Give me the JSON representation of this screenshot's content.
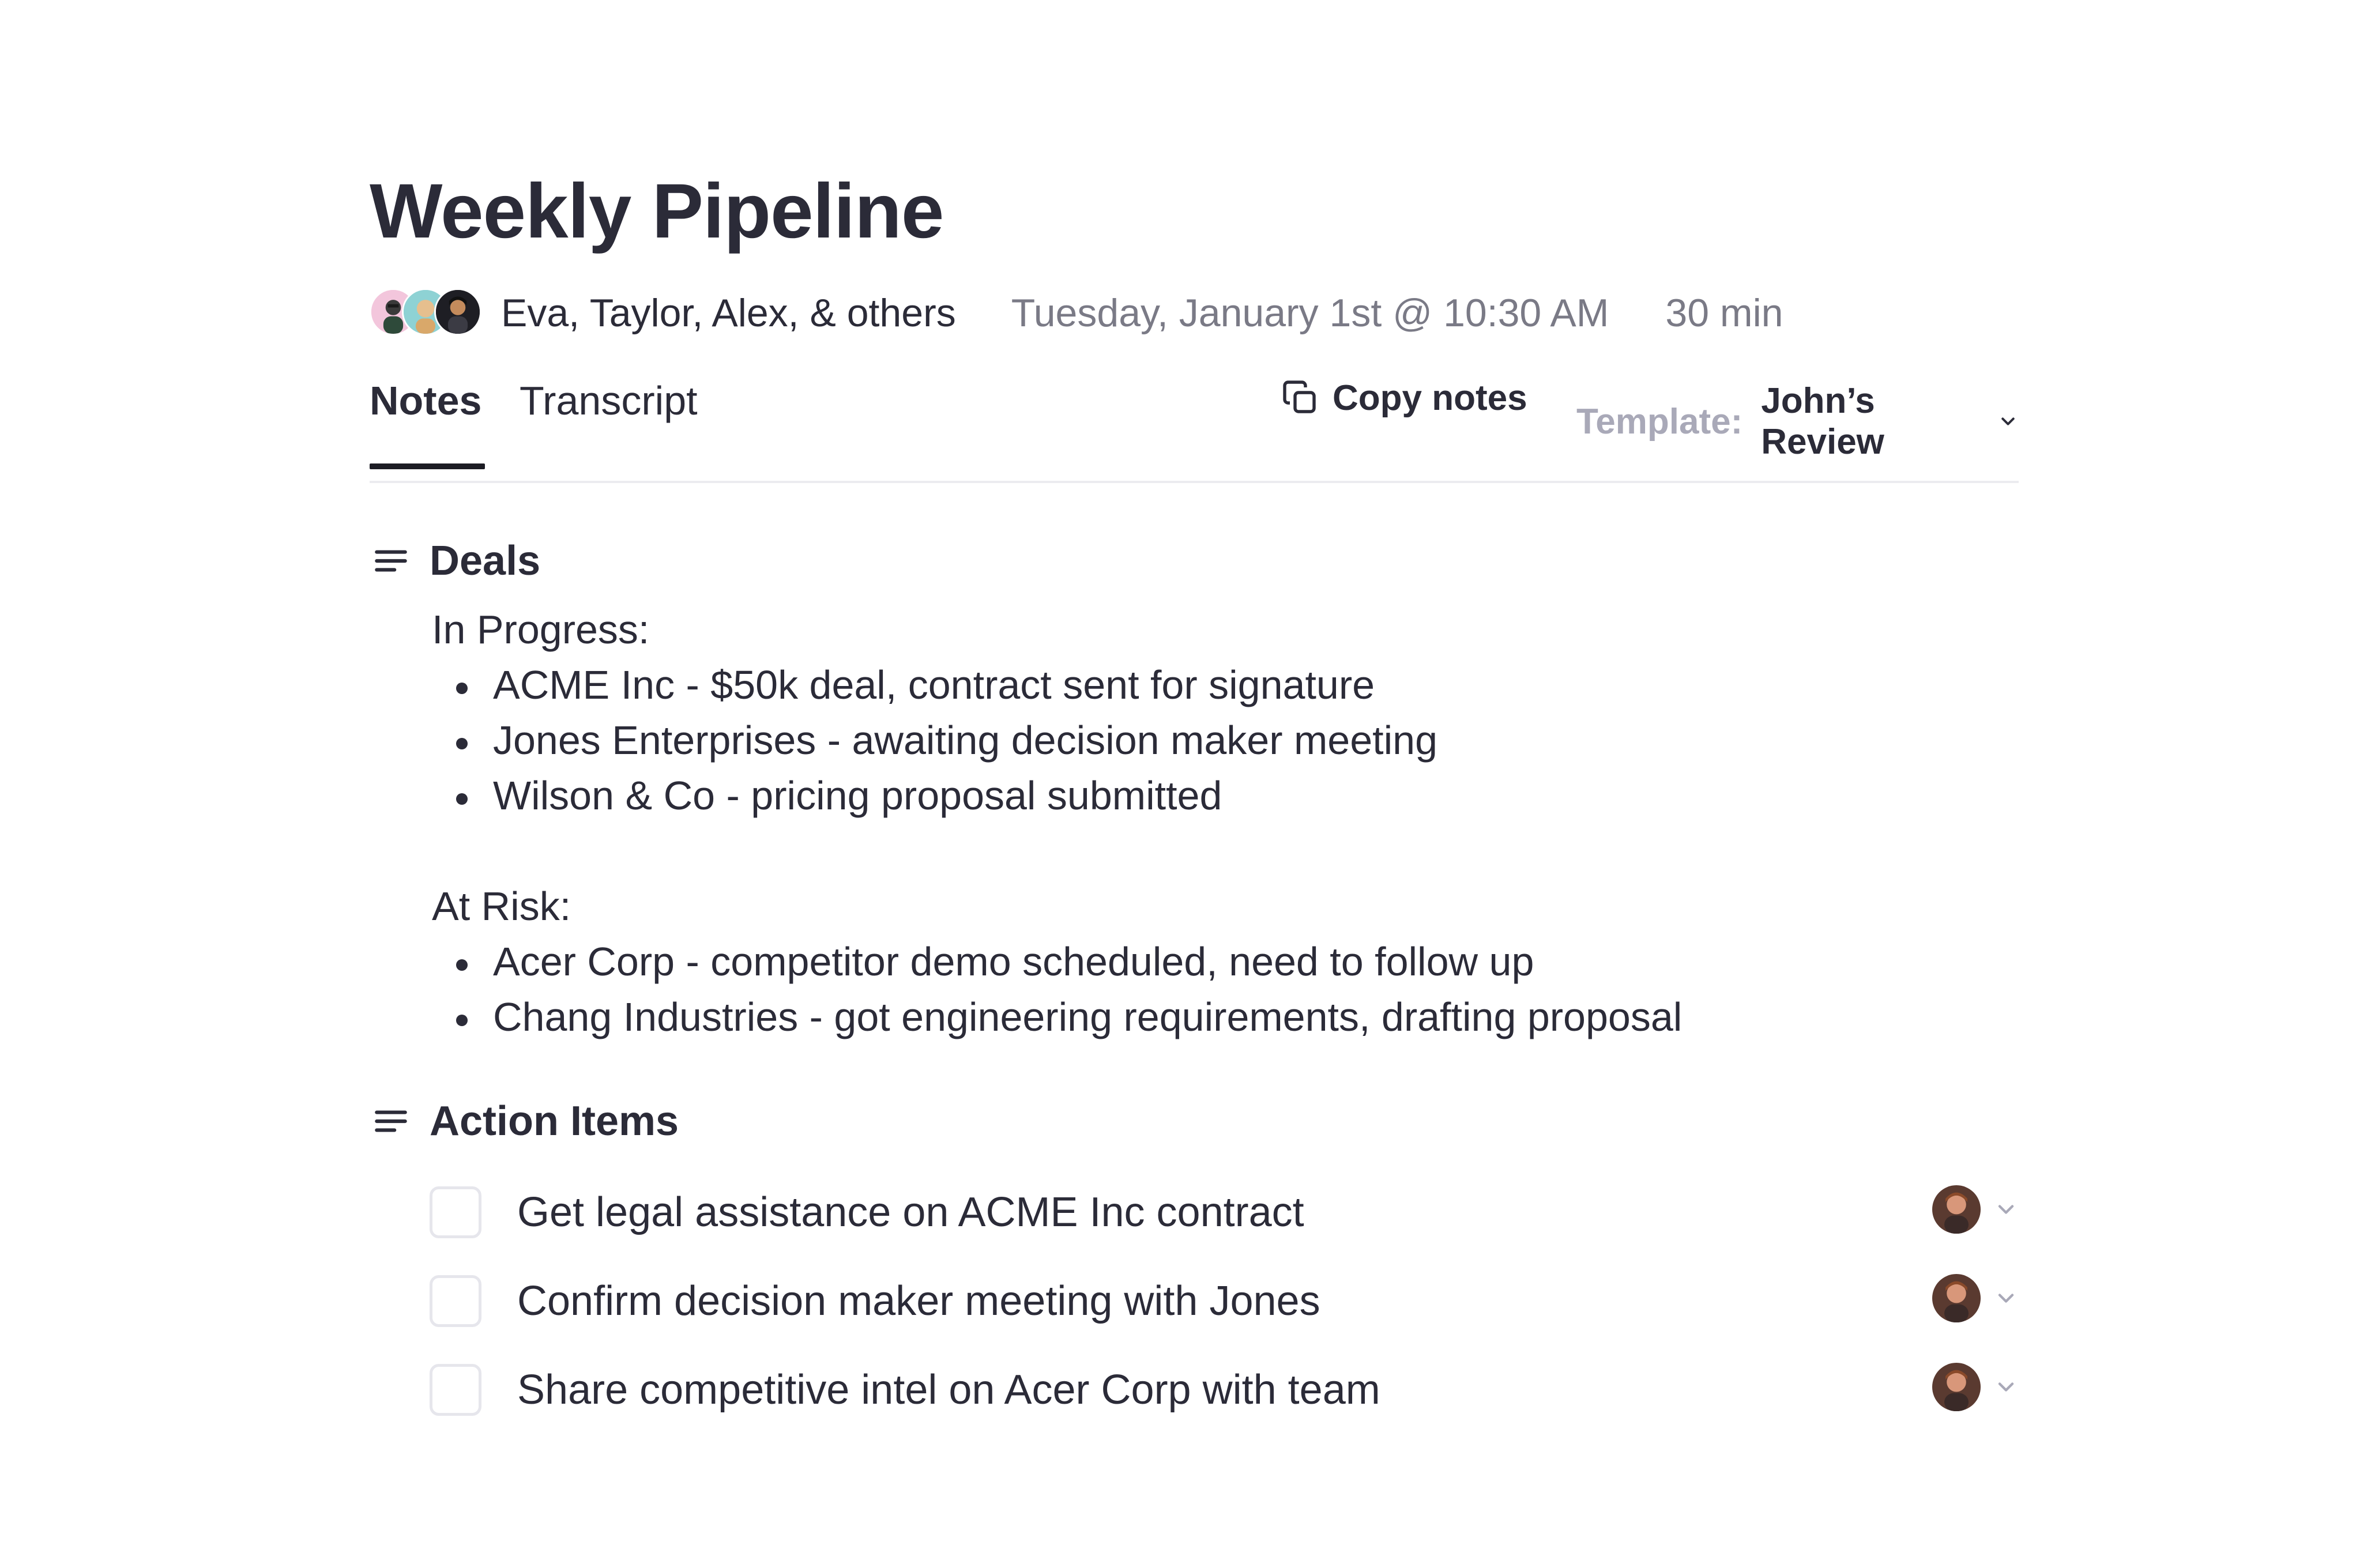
{
  "header": {
    "title": "Weekly Pipeline",
    "participants": "Eva, Taylor, Alex, & others",
    "datetime": "Tuesday, January 1st @ 10:30 AM",
    "duration": "30 min",
    "avatars": [
      "avatar-eva",
      "avatar-taylor",
      "avatar-alex"
    ]
  },
  "tabs": {
    "notes": "Notes",
    "transcript": "Transcript",
    "active": "Notes"
  },
  "toolbar": {
    "copy_label": "Copy notes",
    "copy_icon": "copy-icon",
    "template_label": "Template:",
    "template_value": "John’s Review"
  },
  "deals": {
    "title": "Deals",
    "icon": "text-align-icon",
    "in_progress_label": "In Progress:",
    "in_progress": [
      "ACME Inc - $50k deal, contract sent for signature",
      "Jones Enterprises - awaiting decision maker meeting",
      "Wilson & Co - pricing proposal submitted"
    ],
    "at_risk_label": "At Risk:",
    "at_risk": [
      "Acer Corp - competitor demo scheduled, need to follow up",
      "Chang Industries - got engineering requirements, drafting proposal"
    ]
  },
  "actions": {
    "title": "Action Items",
    "icon": "text-align-icon",
    "items": [
      {
        "text": "Get legal assistance on ACME Inc contract",
        "checked": false
      },
      {
        "text": "Confirm decision maker meeting with Jones",
        "checked": false
      },
      {
        "text": "Share competitive intel on Acer Corp with team",
        "checked": false
      }
    ]
  },
  "colors": {
    "text": "#2b2b38",
    "muted": "#7a7a86",
    "template_label": "#a9a9b8",
    "divider": "#ececf0",
    "tab_underline": "#1c1c24"
  }
}
